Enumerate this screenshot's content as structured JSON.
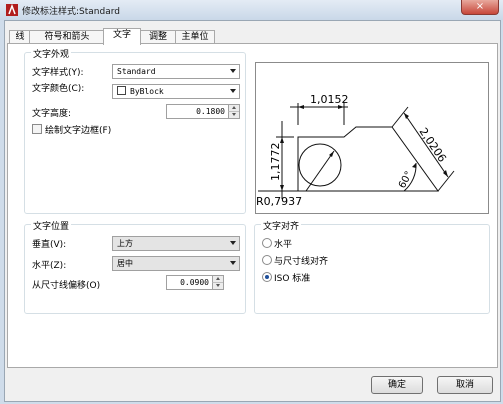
{
  "window": {
    "title": "修改标注样式:Standard",
    "close_glyph": "×"
  },
  "tabs": [
    {
      "label": "线"
    },
    {
      "label": "符号和箭头"
    },
    {
      "label": "文字"
    },
    {
      "label": "调整"
    },
    {
      "label": "主单位"
    }
  ],
  "active_tab": "文字",
  "appearance": {
    "title": "文字外观",
    "style_label": "文字样式(Y):",
    "style_value": "Standard",
    "color_label": "文字颜色(C):",
    "color_value": "ByBlock",
    "height_label": "文字高度:",
    "height_value": "0.1800",
    "frame_label": "绘制文字边框(F)",
    "frame_checked": false
  },
  "position": {
    "title": "文字位置",
    "vertical_label": "垂直(V):",
    "vertical_value": "上方",
    "horizontal_label": "水平(Z):",
    "horizontal_value": "居中",
    "offset_label": "从尺寸线偏移(O)",
    "offset_value": "0.0900"
  },
  "alignment": {
    "title": "文字对齐",
    "options": [
      {
        "label": "水平",
        "selected": false
      },
      {
        "label": "与尺寸线对齐",
        "selected": false
      },
      {
        "label": "ISO 标准",
        "selected": true
      }
    ]
  },
  "preview": {
    "dim_top": "1,0152",
    "dim_left": "1,1772",
    "dim_diag": "2,0206",
    "dim_radius": "R0,7937",
    "dim_angle": "60°"
  },
  "buttons": {
    "ok": "确定",
    "cancel": "取消"
  }
}
